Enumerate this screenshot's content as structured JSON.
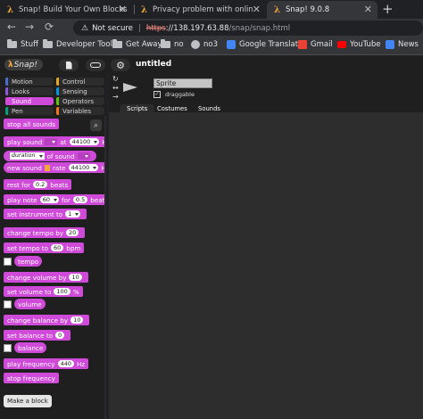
{
  "browser": {
    "tabs": [
      {
        "title": "Snap! Build Your Own Blocks",
        "active": false
      },
      {
        "title": "Privacy problem with online editor",
        "active": false
      },
      {
        "title": "Snap! 9.0.8",
        "active": true
      }
    ],
    "new_tab": "+",
    "address": {
      "warning": "Not secure",
      "scheme": "https",
      "host": "://138.197.63.88",
      "path": "/snap/snap.html"
    },
    "bookmarks": [
      {
        "label": "Stuff",
        "icon": "folder-icon"
      },
      {
        "label": "Developer Tools",
        "icon": "folder-icon"
      },
      {
        "label": "Get Away",
        "icon": "folder-icon"
      },
      {
        "label": "no",
        "icon": "folder-icon"
      },
      {
        "label": "no3",
        "icon": "globe-icon"
      },
      {
        "label": "Google Translate",
        "icon": "translate-icon"
      },
      {
        "label": "Gmail",
        "icon": "gmail-icon"
      },
      {
        "label": "YouTube",
        "icon": "youtube-icon"
      },
      {
        "label": "News",
        "icon": "news-icon"
      }
    ]
  },
  "snap": {
    "logo": "Snap!",
    "project_title": "untitled",
    "categories": [
      {
        "label": "Motion",
        "color": "#4a6cd4",
        "selected": false
      },
      {
        "label": "Control",
        "color": "#e6a822",
        "selected": false
      },
      {
        "label": "Looks",
        "color": "#8f56e3",
        "selected": false
      },
      {
        "label": "Sensing",
        "color": "#0494dc",
        "selected": false
      },
      {
        "label": "Sound",
        "color": "#cf4ad9",
        "selected": true
      },
      {
        "label": "Operators",
        "color": "#62c213",
        "selected": false
      },
      {
        "label": "Pen",
        "color": "#00a178",
        "selected": false
      },
      {
        "label": "Variables",
        "color": "#f3761d",
        "selected": false
      }
    ],
    "palette": {
      "stop_all_sounds": "stop all sounds",
      "play_sound": {
        "label": "play sound",
        "at": "at",
        "hz_value": "44100",
        "hz": "Hz"
      },
      "duration_of_sound": {
        "attr": "duration",
        "label": "of sound"
      },
      "new_sound": {
        "label": "new sound",
        "rate": "rate",
        "hz_value": "44100",
        "hz": "Hz"
      },
      "rest_for": {
        "label": "rest for",
        "value": "0.2",
        "unit": "beats"
      },
      "play_note": {
        "label": "play note",
        "value": "60",
        "for": "for",
        "beats_value": "0.5",
        "unit": "beats"
      },
      "set_instrument": {
        "label": "set instrument to",
        "value": "1"
      },
      "change_tempo": {
        "label": "change tempo by",
        "value": "20"
      },
      "set_tempo": {
        "label": "set tempo to",
        "value": "60",
        "unit": "bpm"
      },
      "tempo_reporter": "tempo",
      "change_volume": {
        "label": "change volume by",
        "value": "10"
      },
      "set_volume": {
        "label": "set volume to",
        "value": "100",
        "unit": "%"
      },
      "volume_reporter": "volume",
      "change_balance": {
        "label": "change balance by",
        "value": "10"
      },
      "set_balance": {
        "label": "set balance to",
        "value": "0"
      },
      "balance_reporter": "balance",
      "play_frequency": {
        "label": "play frequency",
        "value": "440",
        "unit": "Hz"
      },
      "stop_frequency": "stop frequency",
      "make_block": "Make a block"
    },
    "sprite": {
      "name": "Sprite",
      "draggable_label": "draggable",
      "draggable_checked": true
    },
    "sprite_tabs": [
      "Scripts",
      "Costumes",
      "Sounds"
    ]
  }
}
